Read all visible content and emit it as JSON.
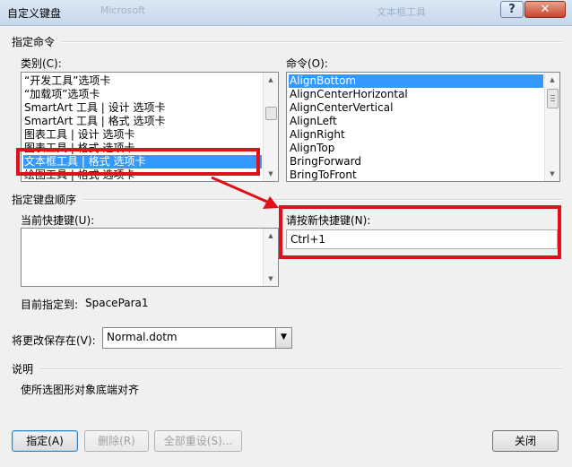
{
  "window": {
    "title": "自定义键盘",
    "ghost_left": "Microsoft",
    "ghost_right": "文本框工具",
    "help_label": "?",
    "close_label": "✕"
  },
  "specify_commands": {
    "section_label": "指定命令",
    "categories_label": "类别(C):",
    "categories": [
      "“开发工具”选项卡",
      "“加载项”选项卡",
      "SmartArt 工具 | 设计 选项卡",
      "SmartArt 工具 | 格式 选项卡",
      "图表工具 | 设计 选项卡",
      "图表工具 | 格式 选项卡",
      "文本框工具 | 格式 选项卡",
      "绘图工具 | 格式 选项卡"
    ],
    "selected_category_index": 6,
    "commands_label": "命令(O):",
    "commands": [
      "AlignBottom",
      "AlignCenterHorizontal",
      "AlignCenterVertical",
      "AlignLeft",
      "AlignRight",
      "AlignTop",
      "BringForward",
      "BringToFront"
    ],
    "selected_command_index": 0
  },
  "keyboard_sequence": {
    "section_label": "指定键盘顺序",
    "current_keys_label": "当前快捷键(U):",
    "current_keys": [],
    "new_key_label": "请按新快捷键(N):",
    "new_key_value": "Ctrl+1",
    "assigned_to_label": "目前指定到:",
    "assigned_to_value": "SpacePara1"
  },
  "save_changes": {
    "label": "将更改保存在(V):",
    "value": "Normal.dotm"
  },
  "description": {
    "section_label": "说明",
    "text": "使所选图形对象底端对齐"
  },
  "buttons": {
    "assign": "指定(A)",
    "remove": "删除(R)",
    "reset_all": "全部重设(S)...",
    "close": "关闭"
  },
  "annotation": {
    "color": "#e0101a"
  }
}
